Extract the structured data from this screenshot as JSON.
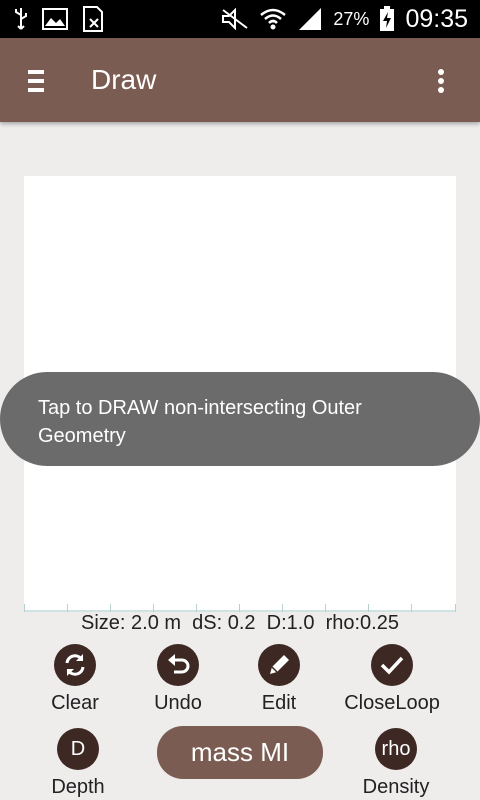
{
  "status_bar": {
    "battery_text": "27%",
    "clock": "09:35",
    "icons": [
      "usb-icon",
      "gallery-icon",
      "sim-off-icon",
      "mute-icon",
      "wifi-icon",
      "signal-icon",
      "battery-charging-icon"
    ]
  },
  "app_bar": {
    "title": "Draw",
    "menu_icon": "hamburger-icon",
    "overflow_icon": "overflow-menu-icon"
  },
  "toast": {
    "message": "Tap to DRAW non-intersecting Outer Geometry"
  },
  "info_line": {
    "text": "Size: 2.0 m  dS: 0.2  D:1.0  rho:0.25"
  },
  "tools": {
    "clear": {
      "label": "Clear",
      "icon": "refresh-icon"
    },
    "undo": {
      "label": "Undo",
      "icon": "undo-icon"
    },
    "edit": {
      "label": "Edit",
      "icon": "pencil-icon"
    },
    "close_loop": {
      "label": "CloseLoop",
      "icon": "check-icon"
    },
    "depth": {
      "label": "Depth",
      "glyph": "D"
    },
    "density": {
      "label": "Density",
      "glyph": "rho"
    }
  },
  "mass_button": {
    "label": "mass MI"
  },
  "colors": {
    "app_bar": "#7a5c52",
    "icon_circle": "#3d2824",
    "background": "#efecec",
    "toast": "#6b6b6b"
  }
}
